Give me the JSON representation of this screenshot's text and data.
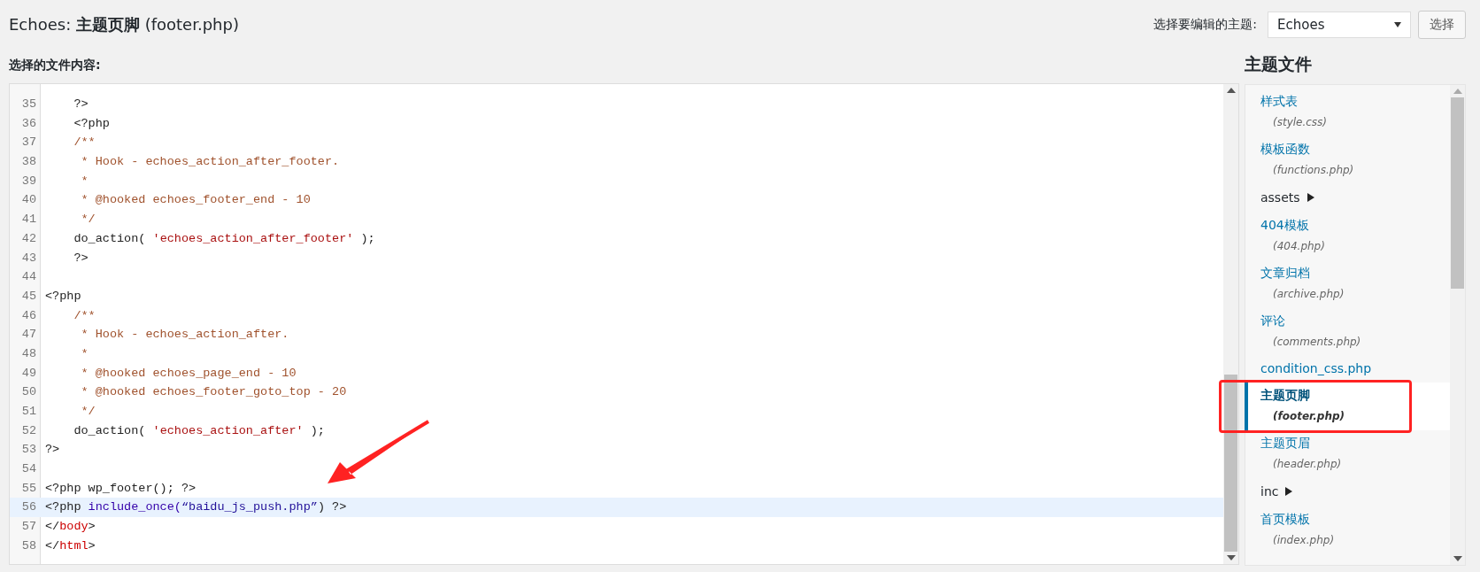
{
  "header": {
    "title_prefix": "Echoes:",
    "title_name": "主题页脚",
    "title_file": "(footer.php)",
    "theme_label": "选择要编辑的主题:",
    "theme_select": "Echoes",
    "select_button": "选择"
  },
  "editor": {
    "label": "选择的文件内容:",
    "lines": [
      {
        "number": "35",
        "highlighted": false,
        "tokens": [
          {
            "kind": "plain",
            "text": "    ?>"
          }
        ]
      },
      {
        "number": "36",
        "highlighted": false,
        "tokens": [
          {
            "kind": "plain",
            "text": "    <?php"
          }
        ]
      },
      {
        "number": "37",
        "highlighted": false,
        "tokens": [
          {
            "kind": "comment",
            "text": "    /**"
          }
        ]
      },
      {
        "number": "38",
        "highlighted": false,
        "tokens": [
          {
            "kind": "comment",
            "text": "     * Hook - echoes_action_after_footer."
          }
        ]
      },
      {
        "number": "39",
        "highlighted": false,
        "tokens": [
          {
            "kind": "comment",
            "text": "     *"
          }
        ]
      },
      {
        "number": "40",
        "highlighted": false,
        "tokens": [
          {
            "kind": "comment",
            "text": "     * @hooked echoes_footer_end - 10"
          }
        ]
      },
      {
        "number": "41",
        "highlighted": false,
        "tokens": [
          {
            "kind": "comment",
            "text": "     */"
          }
        ]
      },
      {
        "number": "42",
        "highlighted": false,
        "tokens": [
          {
            "kind": "plain",
            "text": "    do_action( "
          },
          {
            "kind": "string",
            "text": "'echoes_action_after_footer'"
          },
          {
            "kind": "plain",
            "text": " );"
          }
        ]
      },
      {
        "number": "43",
        "highlighted": false,
        "tokens": [
          {
            "kind": "plain",
            "text": "    ?>"
          }
        ]
      },
      {
        "number": "44",
        "highlighted": false
      },
      {
        "number": "45",
        "highlighted": false,
        "tokens": [
          {
            "kind": "plain",
            "text": "<?php"
          }
        ]
      },
      {
        "number": "46",
        "highlighted": false,
        "tokens": [
          {
            "kind": "comment",
            "text": "    /**"
          }
        ]
      },
      {
        "number": "47",
        "highlighted": false,
        "tokens": [
          {
            "kind": "comment",
            "text": "     * Hook - echoes_action_after."
          }
        ]
      },
      {
        "number": "48",
        "highlighted": false,
        "tokens": [
          {
            "kind": "comment",
            "text": "     *"
          }
        ]
      },
      {
        "number": "49",
        "highlighted": false,
        "tokens": [
          {
            "kind": "comment",
            "text": "     * @hooked echoes_page_end - 10"
          }
        ]
      },
      {
        "number": "50",
        "highlighted": false,
        "tokens": [
          {
            "kind": "comment",
            "text": "     * @hooked echoes_footer_goto_top - 20"
          }
        ]
      },
      {
        "number": "51",
        "highlighted": false,
        "tokens": [
          {
            "kind": "comment",
            "text": "     */"
          }
        ]
      },
      {
        "number": "52",
        "highlighted": false,
        "tokens": [
          {
            "kind": "plain",
            "text": "    do_action( "
          },
          {
            "kind": "string",
            "text": "'echoes_action_after'"
          },
          {
            "kind": "plain",
            "text": " );"
          }
        ]
      },
      {
        "number": "53",
        "highlighted": false,
        "tokens": [
          {
            "kind": "plain",
            "text": "?>"
          }
        ]
      },
      {
        "number": "54",
        "highlighted": false
      },
      {
        "number": "55",
        "highlighted": false,
        "tokens": [
          {
            "kind": "plain",
            "text": "<?php wp_footer(); ?>"
          }
        ]
      },
      {
        "number": "56",
        "highlighted": true,
        "tokens": [
          {
            "kind": "plain",
            "text": "<?php "
          },
          {
            "kind": "keyword",
            "text": "include_once("
          },
          {
            "kind": "string2",
            "text": "“baidu_js_push.php”"
          },
          {
            "kind": "plain",
            "text": ") ?>"
          }
        ]
      },
      {
        "number": "57",
        "highlighted": false,
        "tokens": [
          {
            "kind": "plain",
            "text": "</"
          },
          {
            "kind": "tag",
            "text": "body"
          },
          {
            "kind": "plain",
            "text": ">"
          }
        ]
      },
      {
        "number": "58",
        "highlighted": false,
        "tokens": [
          {
            "kind": "plain",
            "text": "</"
          },
          {
            "kind": "tag",
            "text": "html"
          },
          {
            "kind": "plain",
            "text": ">"
          }
        ]
      }
    ]
  },
  "sidebar": {
    "title": "主题文件",
    "items": [
      {
        "kind": "file",
        "label": "样式表",
        "file": "(style.css)",
        "selected": false
      },
      {
        "kind": "file",
        "label": "模板函数",
        "file": "(functions.php)",
        "selected": false
      },
      {
        "kind": "folder",
        "label": "assets",
        "selected": false
      },
      {
        "kind": "file",
        "label": "404模板",
        "file": "(404.php)",
        "selected": false
      },
      {
        "kind": "file",
        "label": "文章归档",
        "file": "(archive.php)",
        "selected": false
      },
      {
        "kind": "file",
        "label": "评论",
        "file": "(comments.php)",
        "selected": false
      },
      {
        "kind": "file",
        "label": "condition_css.php",
        "selected": false
      },
      {
        "kind": "file",
        "label": "主题页脚",
        "file": "(footer.php)",
        "selected": true
      },
      {
        "kind": "file",
        "label": "主题页眉",
        "file": "(header.php)",
        "selected": false
      },
      {
        "kind": "folder",
        "label": "inc",
        "selected": false
      },
      {
        "kind": "file",
        "label": "首页模板",
        "file": "(index.php)",
        "selected": false
      }
    ]
  }
}
